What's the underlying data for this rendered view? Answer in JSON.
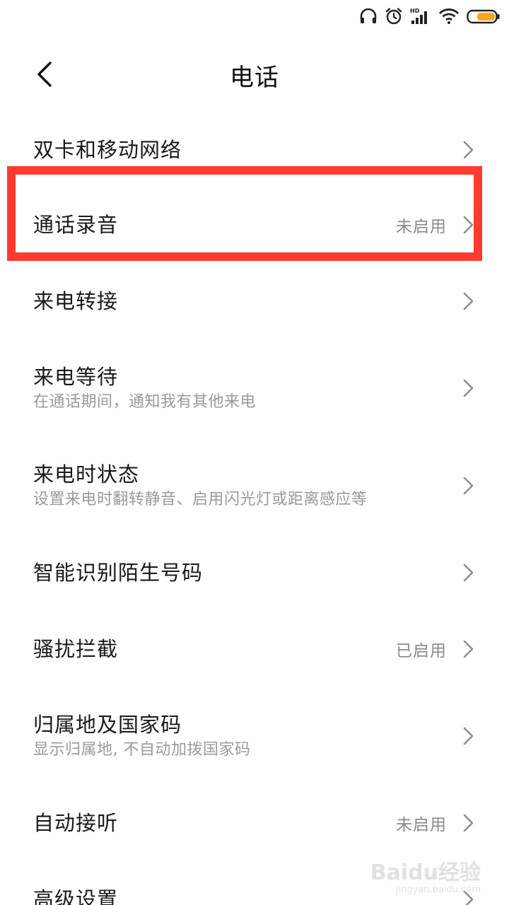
{
  "header": {
    "title": "电话",
    "back_icon": "chevron-left-icon"
  },
  "status_bar": {
    "icons": [
      "headphones-icon",
      "alarm-icon",
      "hd-signal-icon",
      "wifi-icon",
      "battery-icon"
    ],
    "hd_label": "HD",
    "battery_color": "#f5a623"
  },
  "items": [
    {
      "title": "双卡和移动网络",
      "subtitle": "",
      "value": ""
    },
    {
      "title": "通话录音",
      "subtitle": "",
      "value": "未启用"
    },
    {
      "title": "来电转接",
      "subtitle": "",
      "value": ""
    },
    {
      "title": "来电等待",
      "subtitle": "在通话期间，通知我有其他来电",
      "value": ""
    },
    {
      "title": "来电时状态",
      "subtitle": "设置来电时翻转静音、启用闪光灯或距离感应等",
      "value": ""
    },
    {
      "title": "智能识别陌生号码",
      "subtitle": "",
      "value": ""
    },
    {
      "title": "骚扰拦截",
      "subtitle": "",
      "value": "已启用"
    },
    {
      "title": "归属地及国家码",
      "subtitle": "显示归属地, 不自动加拨国家码",
      "value": ""
    },
    {
      "title": "自动接听",
      "subtitle": "",
      "value": "未启用"
    },
    {
      "title": "高级设置",
      "subtitle": "",
      "value": ""
    }
  ],
  "highlight": {
    "color": "#ff3b30",
    "target": "通话录音"
  },
  "watermark": {
    "brand": "Baidu经验",
    "url": "jingyan.baidu.com"
  }
}
